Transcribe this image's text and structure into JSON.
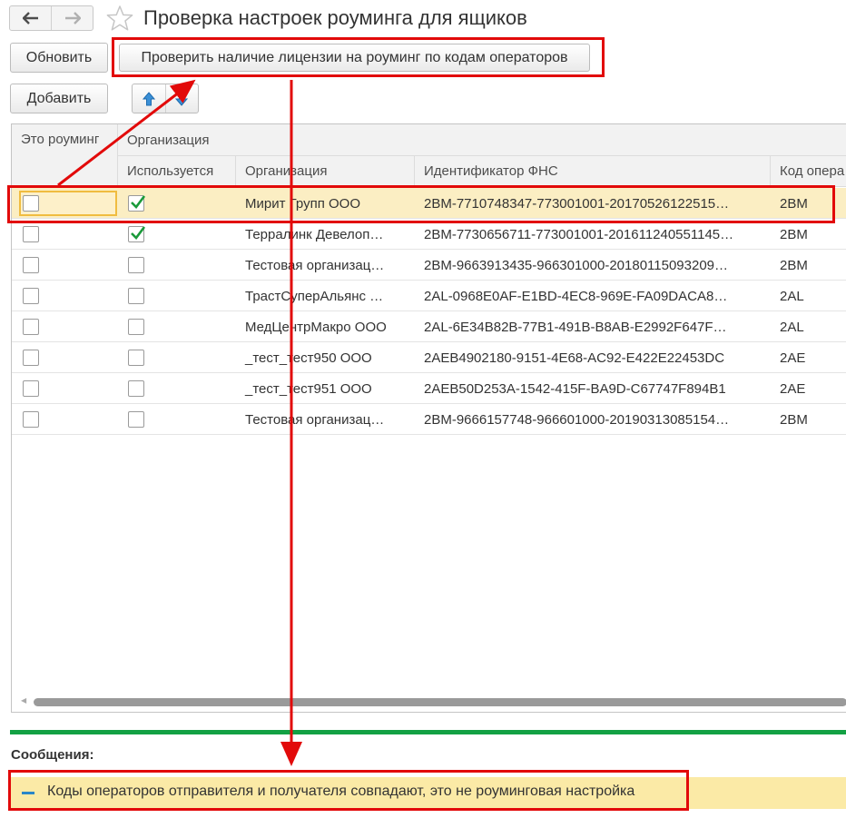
{
  "window": {
    "back_icon": "arrow-left-icon",
    "forward_icon": "arrow-right-icon",
    "favorite_icon": "star-icon",
    "title": "Проверка настроек роуминга для ящиков"
  },
  "toolbar": {
    "refresh_label": "Обновить",
    "check_license_label": "Проверить наличие лицензии на роуминг по кодам операторов",
    "add_label": "Добавить",
    "move_up_icon": "arrow-up-icon",
    "move_down_icon": "arrow-down-icon"
  },
  "table": {
    "group_header": "Организация",
    "columns": {
      "is_roaming": "Это роуминг",
      "used": "Используется",
      "organization": "Организация",
      "fns_id": "Идентификатор ФНС",
      "operator_code": "Код опера"
    },
    "rows": [
      {
        "is_roaming": false,
        "used": true,
        "organization": "Мирит Групп ООО",
        "fns_id": "2BM-7710748347-773001001-20170526122515…",
        "operator_code": "2BM",
        "selected": true
      },
      {
        "is_roaming": false,
        "used": true,
        "organization": "Терралинк Девелоп…",
        "fns_id": "2BM-7730656711-773001001-201611240551145…",
        "operator_code": "2BM",
        "selected": false
      },
      {
        "is_roaming": false,
        "used": false,
        "organization": "Тестовая организац…",
        "fns_id": "2BM-9663913435-966301000-2018011509320​9…",
        "operator_code": "2BM",
        "selected": false
      },
      {
        "is_roaming": false,
        "used": false,
        "organization": "ТрастСуперАльянс …",
        "fns_id": "2AL-0968E0AF-E1BD-4EC8-969E-FA09DACA8…",
        "operator_code": "2AL",
        "selected": false
      },
      {
        "is_roaming": false,
        "used": false,
        "organization": "МедЦентрМакро ООО",
        "fns_id": "2AL-6E34B82B-77B1-491B-B8AB-E2992F647F…",
        "operator_code": "2AL",
        "selected": false
      },
      {
        "is_roaming": false,
        "used": false,
        "organization": "_тест_тест950 ООО",
        "fns_id": "2AEB4902180-9151-4E68-AC92-E422E22453DC",
        "operator_code": "2AE",
        "selected": false
      },
      {
        "is_roaming": false,
        "used": false,
        "organization": "_тест_тест951 ООО",
        "fns_id": "2AEB50D253A-1542-415F-BA9D-C67747F894B1",
        "operator_code": "2AE",
        "selected": false
      },
      {
        "is_roaming": false,
        "used": false,
        "organization": "Тестовая организац…",
        "fns_id": "2BM-9666157748-966601000-20190313085154…",
        "operator_code": "2BM",
        "selected": false
      }
    ]
  },
  "messages": {
    "label": "Сообщения:",
    "items": [
      {
        "text": "Коды операторов отправителя и получателя совпадают, это не роуминговая настройка"
      }
    ]
  },
  "colors": {
    "highlight_red": "#e20a0a",
    "selected_row": "#fbeec3",
    "message_bar": "#fbeaa6",
    "messages_divider": "#13a144",
    "check_green": "#1a9a3a"
  }
}
